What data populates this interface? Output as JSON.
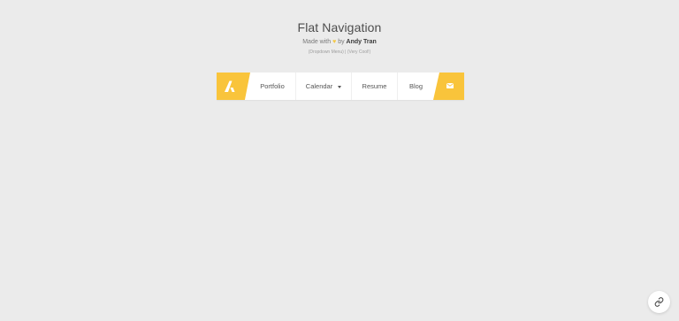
{
  "header": {
    "title": "Flat Navigation",
    "made_with": "Made with",
    "heart_icon": "heart-icon",
    "by": "by",
    "author": "Andy Tran",
    "note": "(Dropdown Menu) | (Very Cool!)"
  },
  "nav": {
    "logo_icon": "logo-a-icon",
    "accent_color": "#f9c43b",
    "items": [
      {
        "label": "Portfolio"
      },
      {
        "label": "Calendar",
        "has_dropdown": true
      },
      {
        "label": "Resume"
      },
      {
        "label": "Blog"
      }
    ],
    "mail_icon": "mail-icon"
  },
  "fab": {
    "icon": "link-icon"
  }
}
